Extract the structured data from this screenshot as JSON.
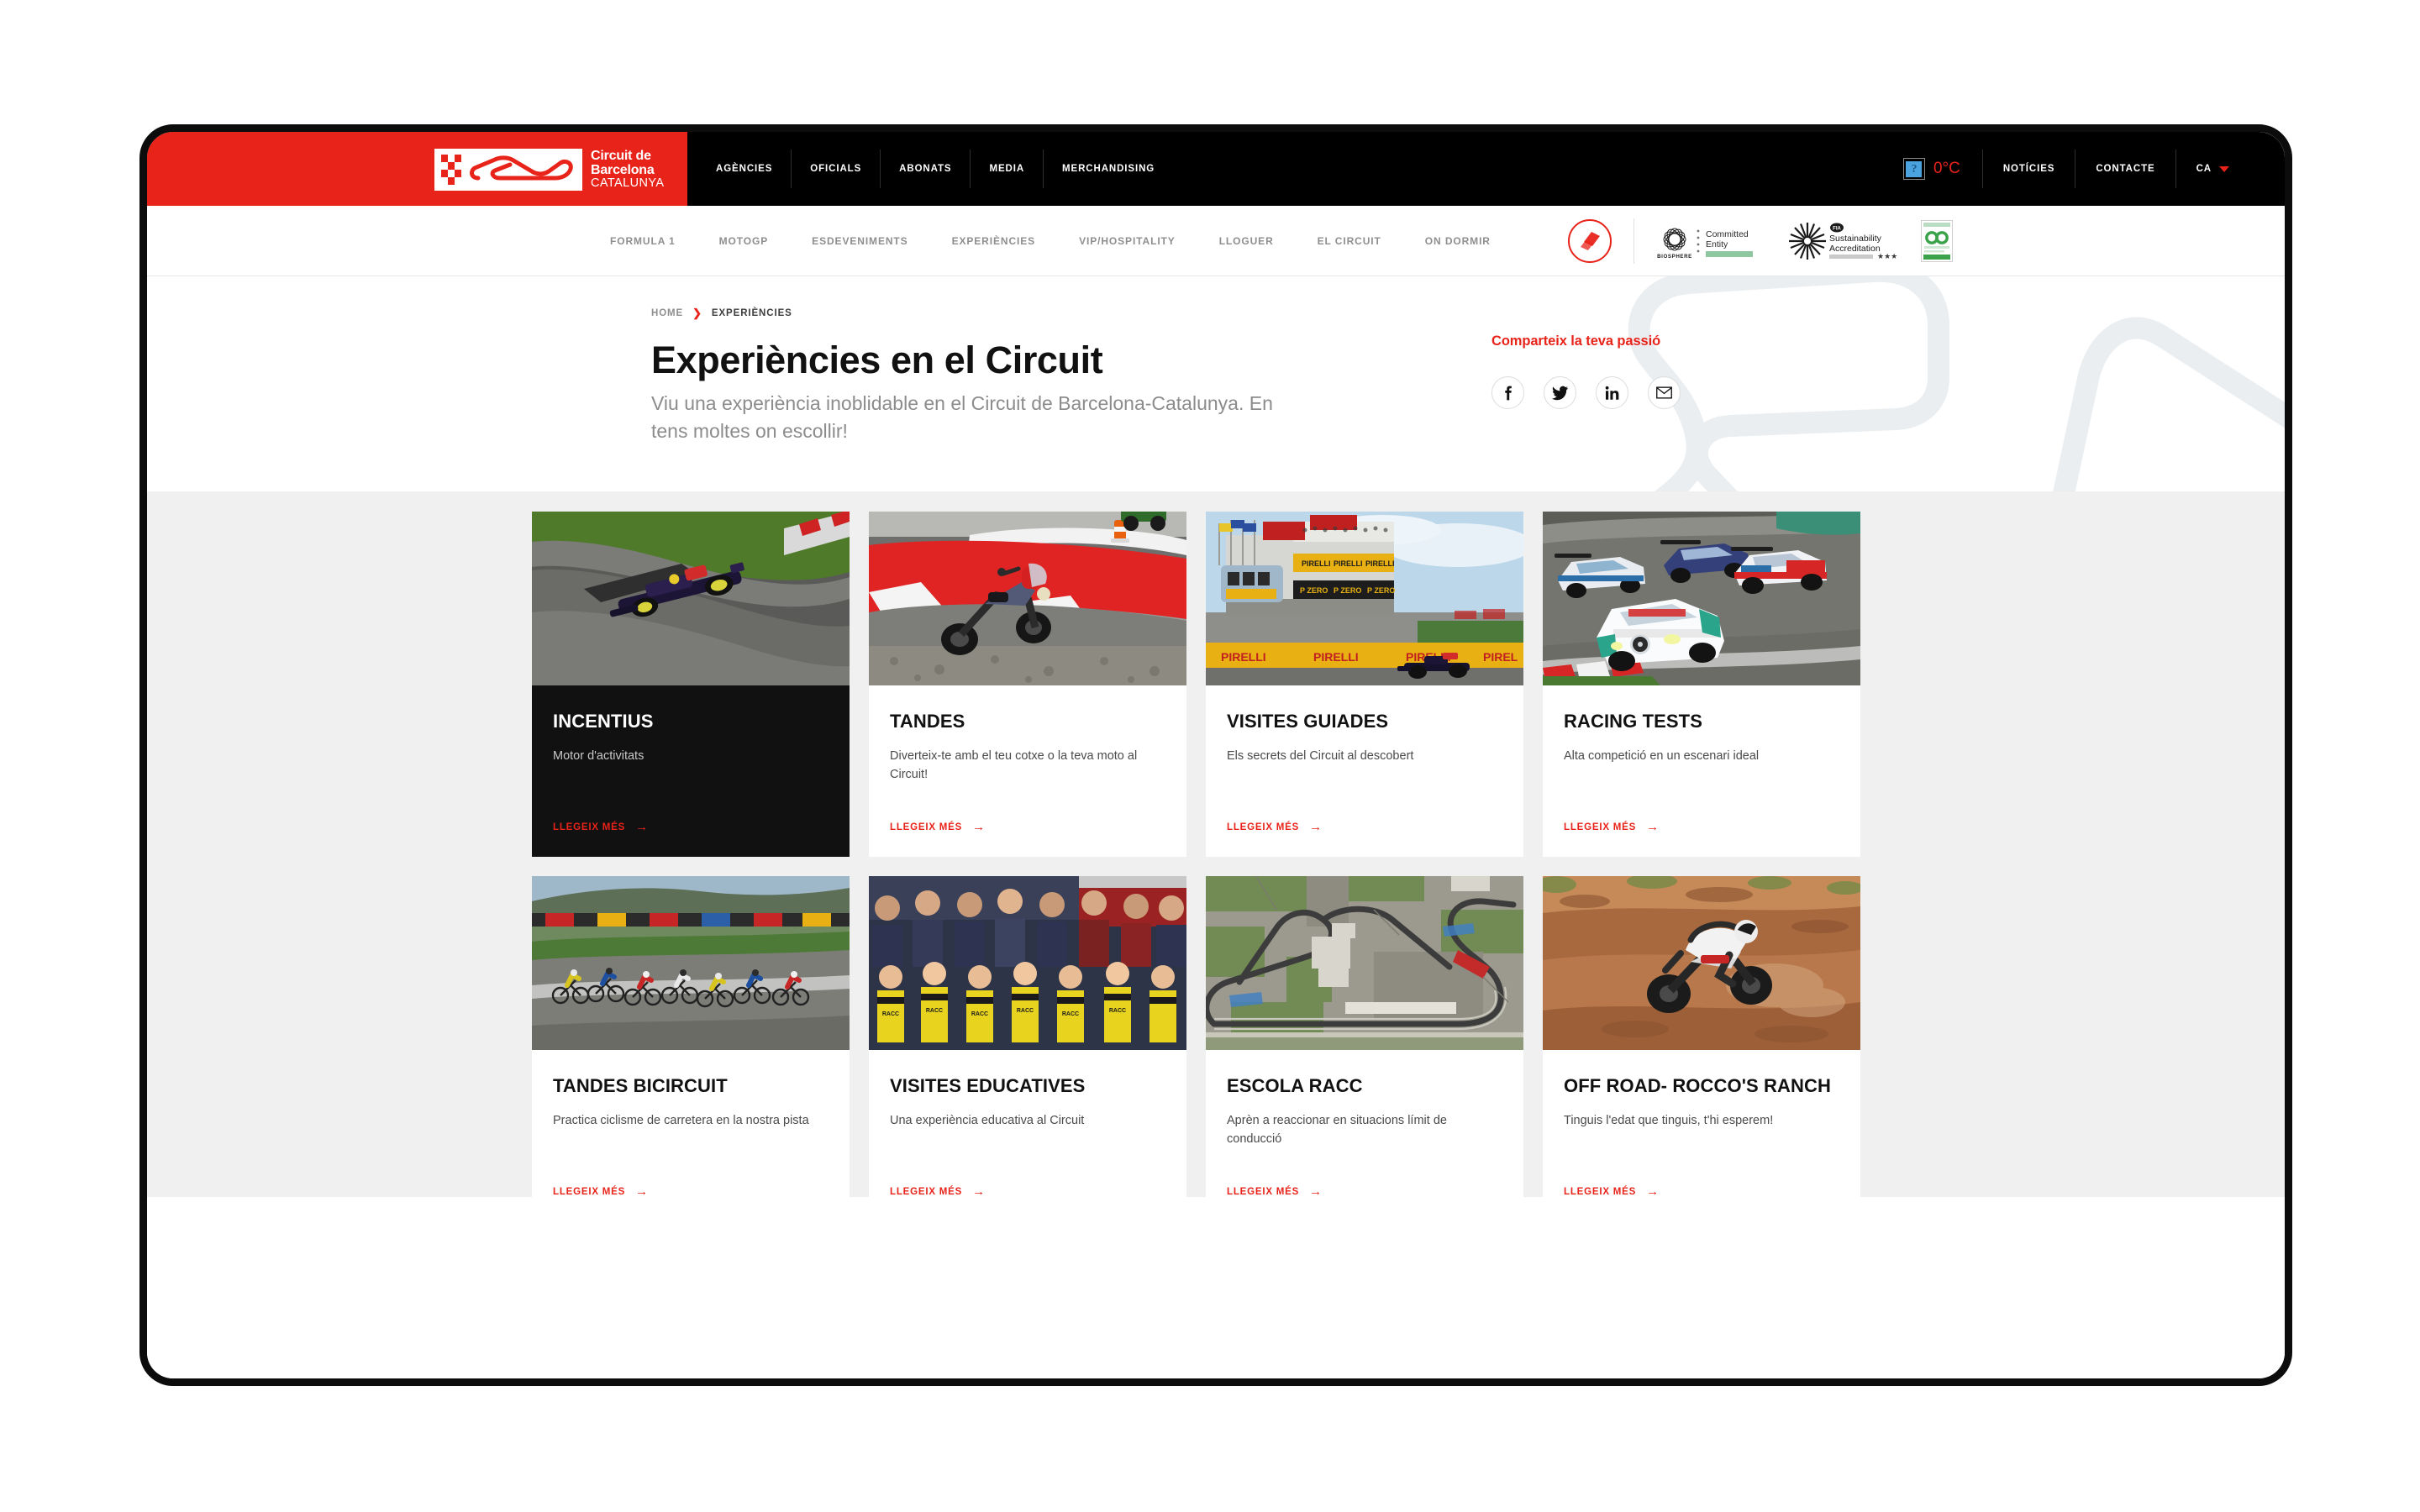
{
  "brand": {
    "logo_line1": "Circuit de",
    "logo_line2": "Barcelona",
    "logo_line3": "CATALUNYA",
    "accent_red": "#e8231a",
    "dark": "#111111"
  },
  "topbar": {
    "nav": [
      {
        "label": "AGÈNCIES",
        "name": "topnav-agencies"
      },
      {
        "label": "OFICIALS",
        "name": "topnav-oficials"
      },
      {
        "label": "ABONATS",
        "name": "topnav-abonats"
      },
      {
        "label": "MEDIA",
        "name": "topnav-media"
      },
      {
        "label": "MERCHANDISING",
        "name": "topnav-merchandising"
      }
    ],
    "weather": {
      "icon": "broken-image-icon",
      "temperature": "0°C"
    },
    "right_links": [
      {
        "label": "NOTÍCIES",
        "name": "topnav-noticies"
      },
      {
        "label": "CONTACTE",
        "name": "topnav-contacte"
      }
    ],
    "language": {
      "value": "CA",
      "icon": "chevron-down-icon"
    }
  },
  "mainnav": {
    "items": [
      {
        "label": "FORMULA 1"
      },
      {
        "label": "MOTOGP"
      },
      {
        "label": "ESDEVENIMENTS"
      },
      {
        "label": "EXPERIÈNCIES"
      },
      {
        "label": "VIP/HOSPITALITY"
      },
      {
        "label": "LLOGUER"
      },
      {
        "label": "EL CIRCUIT"
      },
      {
        "label": "ON DORMIR"
      }
    ],
    "tickets_icon": "tickets-icon",
    "certifications": [
      {
        "name": "biosphere-committed-entity-badge",
        "line1": "Committed",
        "line2": "Entity",
        "wordmark": "BIOSPHERE"
      },
      {
        "name": "fia-sustainability-accreditation-badge",
        "line1": "Sustainability",
        "line2": "Accreditation",
        "mark": "FIA"
      },
      {
        "name": "carbon-neutral-badge",
        "mark": "CO"
      }
    ]
  },
  "hero": {
    "breadcrumb": {
      "home": "HOME",
      "separator": "❯",
      "current": "EXPERIÈNCIES"
    },
    "title": "Experiències en el Circuit",
    "subtitle": "Viu una experiència inoblidable en el Circuit de Barcelona-Catalunya. En tens moltes on escollir!",
    "share": {
      "title": "Comparteix la teva passió",
      "buttons": [
        {
          "name": "share-facebook-button",
          "icon": "facebook-icon"
        },
        {
          "name": "share-twitter-button",
          "icon": "twitter-icon"
        },
        {
          "name": "share-linkedin-button",
          "icon": "linkedin-icon"
        },
        {
          "name": "share-email-button",
          "icon": "email-icon"
        }
      ]
    }
  },
  "cards": [
    {
      "title": "INCENTIUS",
      "desc": "Motor d'activitats",
      "cta": "LLEGEIX MÉS",
      "dark": true,
      "image": "formula-1-car-on-track"
    },
    {
      "title": "TANDES",
      "desc": "Diverteix-te amb el teu cotxe o la teva moto al Circuit!",
      "cta": "LLEGEIX MÉS",
      "dark": false,
      "image": "motorcycle-on-red-kerb"
    },
    {
      "title": "VISITES GUIADES",
      "desc": "Els secrets del Circuit al descobert",
      "cta": "LLEGEIX MÉS",
      "dark": false,
      "image": "pit-building-grandstand"
    },
    {
      "title": "RACING TESTS",
      "desc": "Alta competició en un escenari ideal",
      "cta": "LLEGEIX MÉS",
      "dark": false,
      "image": "gt-race-cars"
    },
    {
      "title": "TANDES BICIRCUIT",
      "desc": "Practica ciclisme de carretera en la nostra pista",
      "cta": "LLEGEIX MÉS",
      "dark": false,
      "image": "cyclists-on-track"
    },
    {
      "title": "VISITES EDUCATIVES",
      "desc": "Una experiència educativa al Circuit",
      "cta": "LLEGEIX MÉS",
      "dark": false,
      "image": "children-group-photo"
    },
    {
      "title": "ESCOLA RACC",
      "desc": "Aprèn a reaccionar en situacions límit de conducció",
      "cta": "LLEGEIX MÉS",
      "dark": false,
      "image": "aerial-view-of-circuit"
    },
    {
      "title": "OFF ROAD- ROCCO'S RANCH",
      "desc": "Tinguis l'edat que tinguis, t'hi esperem!",
      "cta": "LLEGEIX MÉS",
      "dark": false,
      "image": "motocross-rider-in-dirt"
    }
  ]
}
